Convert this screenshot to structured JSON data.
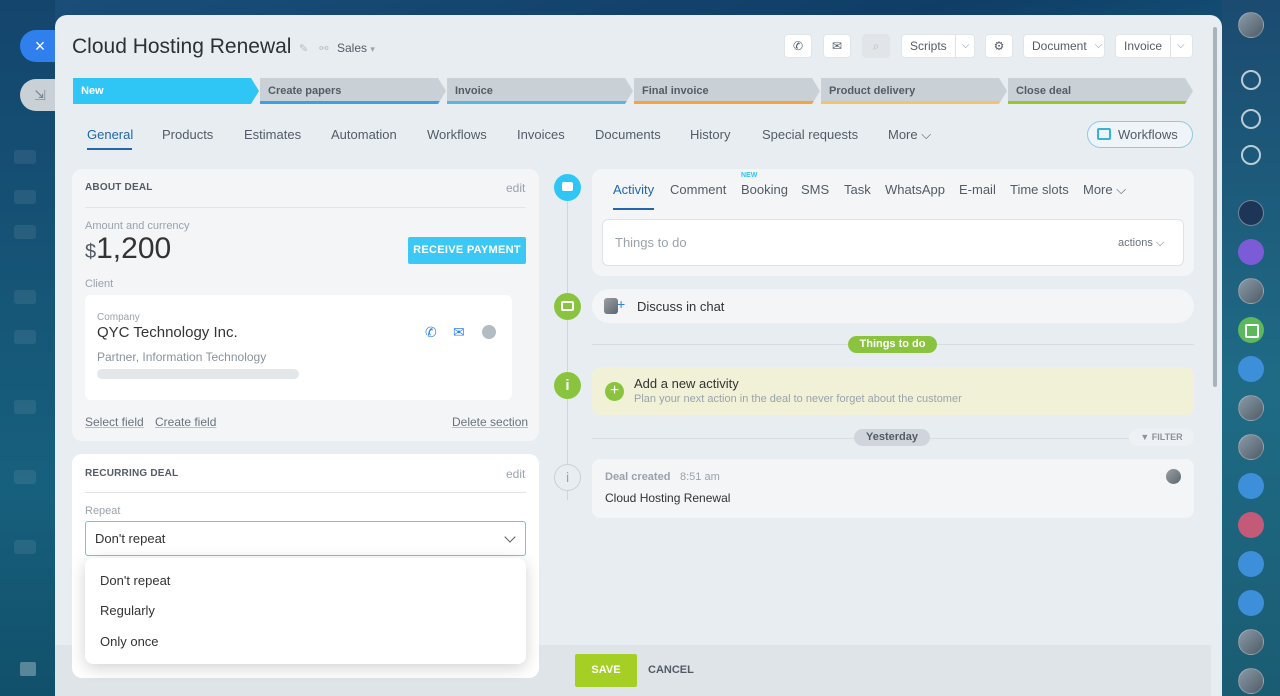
{
  "deal": {
    "title": "Cloud Hosting Renewal",
    "pipeline": "Sales",
    "pipeline_caret": "▾"
  },
  "toolbar": {
    "scripts_label": "Scripts",
    "document_label": "Document",
    "invoice_label": "Invoice",
    "dropdown_glyph": "⌵"
  },
  "stages": [
    {
      "label": "New",
      "color": "#2fc6f6"
    },
    {
      "label": "Create papers",
      "color": "#3ba0e4"
    },
    {
      "label": "Invoice",
      "color": "#55b8e0"
    },
    {
      "label": "Final invoice",
      "color": "#f7a23a"
    },
    {
      "label": "Product delivery",
      "color": "#f5c36b"
    },
    {
      "label": "Close deal",
      "color": "#9bc62a"
    }
  ],
  "tabs": {
    "general": "General",
    "products": "Products",
    "estimates": "Estimates",
    "automation": "Automation",
    "workflows": "Workflows",
    "invoices": "Invoices",
    "documents": "Documents",
    "history": "History",
    "special_requests": "Special requests",
    "more": "More",
    "more_caret": "⌵"
  },
  "workflows_button": "Workflows",
  "about_deal": {
    "heading": "ABOUT DEAL",
    "edit": "edit",
    "amount_label": "Amount and currency",
    "currency_symbol": "$",
    "amount": "1,200",
    "receive_payment": "RECEIVE PAYMENT",
    "client_label": "Client",
    "company_label": "Company",
    "company_name": "QYC Technology Inc.",
    "company_desc": "Partner, Information Technology",
    "select_field": "Select field",
    "create_field": "Create field",
    "delete_section": "Delete section"
  },
  "recurring_deal": {
    "heading": "RECURRING DEAL",
    "edit": "edit",
    "repeat_label": "Repeat",
    "selected": "Don't repeat",
    "options": [
      "Don't repeat",
      "Regularly",
      "Only once"
    ]
  },
  "footer": {
    "save": "SAVE",
    "cancel": "CANCEL"
  },
  "activity": {
    "tabs": [
      "Activity",
      "Comment",
      "Booking",
      "SMS",
      "Task",
      "WhatsApp",
      "E-mail",
      "Time slots",
      "More"
    ],
    "more_caret": "⌵",
    "new_badge": "NEW",
    "todo_placeholder": "Things to do",
    "actions_label": "actions ⌵",
    "discuss_in_chat": "Discuss in chat",
    "things_to_do_chip": "Things to do",
    "add_activity_title": "Add a new activity",
    "add_activity_hint": "Plan your next action in the deal to never forget about the customer",
    "yesterday_chip": "Yesterday",
    "filter_label": "FILTER",
    "deal_created_label": "Deal created",
    "deal_created_time": "8:51 am",
    "deal_created_title": "Cloud Hosting Renewal"
  },
  "icons": {
    "close": "×",
    "minimize": "⇲",
    "plus": "+",
    "info": "i",
    "chat": "▭",
    "flag": "⚑"
  }
}
